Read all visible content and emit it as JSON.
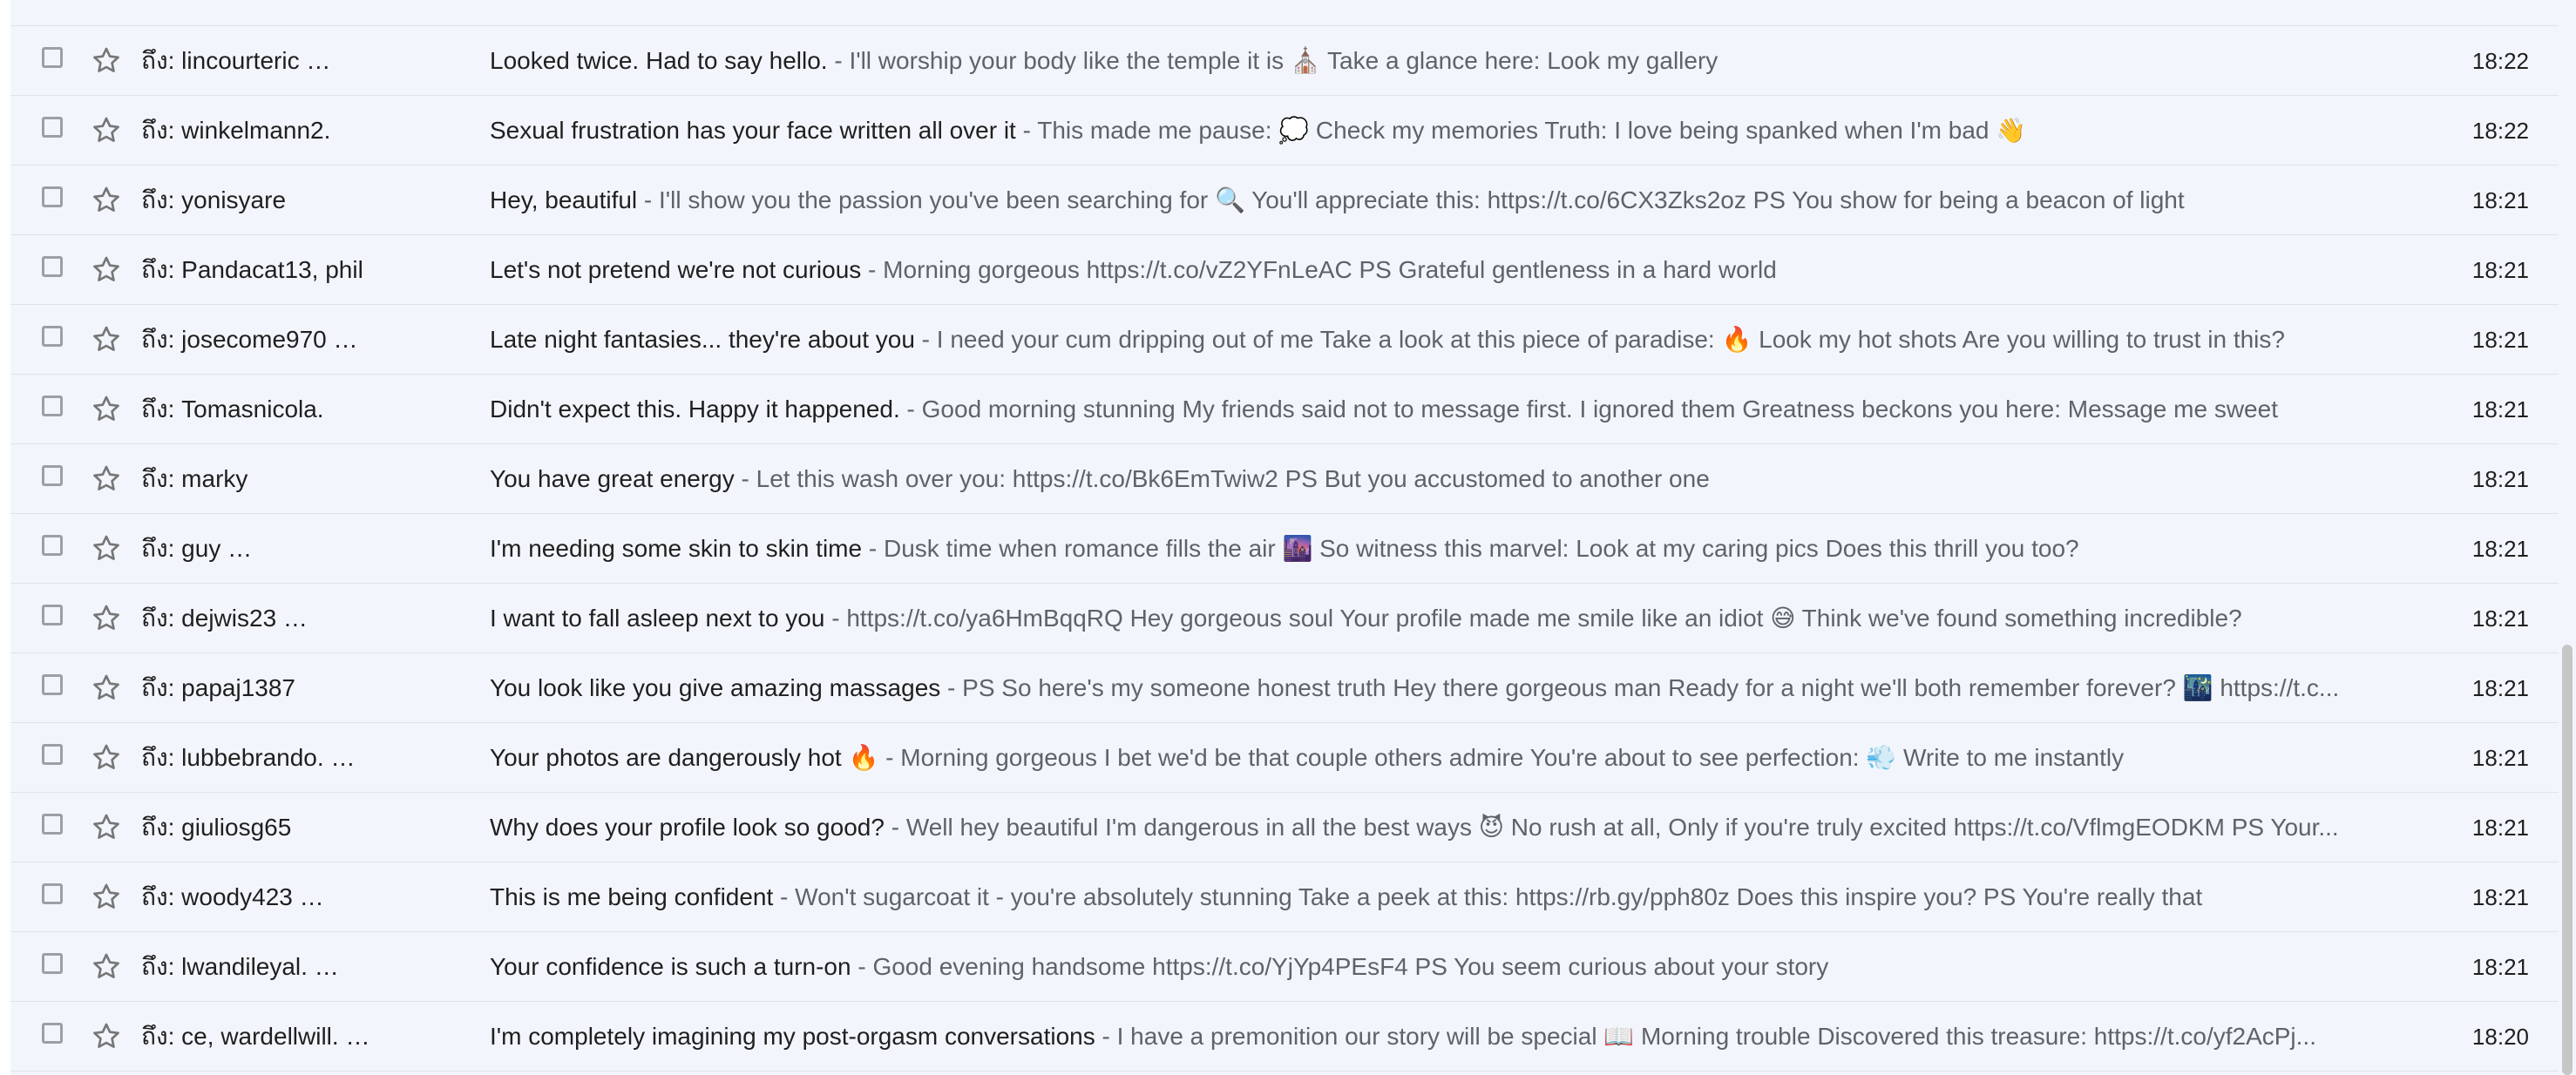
{
  "star_icon": "star-outline-icon",
  "separator": " - ",
  "colors": {
    "background": "#f2f6fc",
    "divider": "#dde3ea",
    "text_primary": "#1f1f1f",
    "text_secondary": "#5f6368"
  },
  "emails": [
    {
      "sender": "ถึง: lincourteric …",
      "subject": "Looked twice. Had to say hello.",
      "snippet": "I'll worship your body like the temple it is ⛪ Take a glance here: Look my gallery",
      "time": "18:22"
    },
    {
      "sender": "ถึง: winkelmann2.",
      "subject": "Sexual frustration has your face written all over it",
      "snippet": "This made me pause: 💭 Check my memories Truth: I love being spanked when I'm bad 👋",
      "time": "18:22"
    },
    {
      "sender": "ถึง: yonisyare",
      "subject": "Hey, beautiful",
      "snippet": "I'll show you the passion you've been searching for 🔍 You'll appreciate this: https://t.co/6CX3Zks2oz PS You show for being a beacon of light",
      "time": "18:21"
    },
    {
      "sender": "ถึง: Pandacat13, phil",
      "subject": "Let's not pretend we're not curious",
      "snippet": "Morning gorgeous https://t.co/vZ2YFnLeAC PS Grateful gentleness in a hard world",
      "time": "18:21"
    },
    {
      "sender": "ถึง: josecome970 …",
      "subject": "Late night fantasies... they're about you",
      "snippet": "I need your cum dripping out of me Take a look at this piece of paradise: 🔥 Look my hot shots Are you willing to trust in this?",
      "time": "18:21"
    },
    {
      "sender": "ถึง: Tomasnicola.",
      "subject": "Didn't expect this. Happy it happened.",
      "snippet": "Good morning stunning My friends said not to message first. I ignored them Greatness beckons you here: Message me sweet",
      "time": "18:21"
    },
    {
      "sender": "ถึง: marky",
      "subject": "You have great energy",
      "snippet": "Let this wash over you: https://t.co/Bk6EmTwiw2 PS But you accustomed to another one",
      "time": "18:21"
    },
    {
      "sender": "ถึง: guy …",
      "subject": "I'm needing some skin to skin time",
      "snippet": "Dusk time when romance fills the air 🌆 So witness this marvel: Look at my caring pics Does this thrill you too?",
      "time": "18:21"
    },
    {
      "sender": "ถึง: dejwis23 …",
      "subject": "I want to fall asleep next to you",
      "snippet": "https://t.co/ya6HmBqqRQ Hey gorgeous soul Your profile made me smile like an idiot 😅 Think we've found something incredible?",
      "time": "18:21"
    },
    {
      "sender": "ถึง: papaj1387",
      "subject": "You look like you give amazing massages",
      "snippet": "PS So here's my someone honest truth Hey there gorgeous man Ready for a night we'll both remember forever? 🌃 https://t.c...",
      "time": "18:21"
    },
    {
      "sender": "ถึง: lubbebrando. …",
      "subject": "Your photos are dangerously hot 🔥",
      "snippet": "Morning gorgeous I bet we'd be that couple others admire You're about to see perfection: 💨 Write to me instantly",
      "time": "18:21"
    },
    {
      "sender": "ถึง: giuliosg65",
      "subject": "Why does your profile look so good?",
      "snippet": "Well hey beautiful I'm dangerous in all the best ways 😈 No rush at all, Only if you're truly excited https://t.co/VflmgEODKM PS Your...",
      "time": "18:21"
    },
    {
      "sender": "ถึง: woody423 …",
      "subject": "This is me being confident",
      "snippet": "Won't sugarcoat it - you're absolutely stunning Take a peek at this: https://rb.gy/pph80z Does this inspire you? PS You're really that",
      "time": "18:21"
    },
    {
      "sender": "ถึง: lwandileyal. …",
      "subject": "Your confidence is such a turn-on",
      "snippet": "Good evening handsome https://t.co/YjYp4PEsF4 PS You seem curious about your story",
      "time": "18:21"
    },
    {
      "sender": "ถึง: ce, wardellwill. …",
      "subject": "I'm completely imagining my post-orgasm conversations",
      "snippet": "I have a premonition our story will be special 📖 Morning trouble Discovered this treasure: https://t.co/yf2AcPj...",
      "time": "18:20"
    }
  ]
}
